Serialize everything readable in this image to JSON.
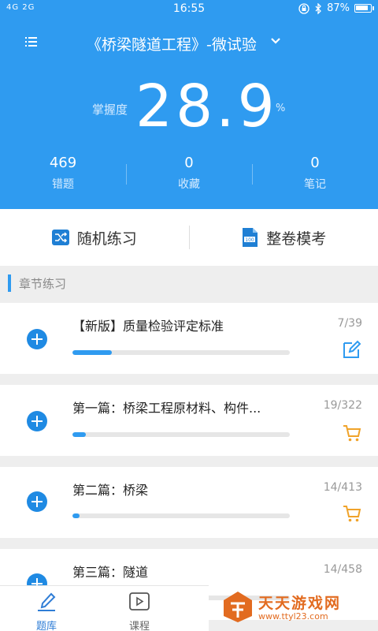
{
  "status_bar": {
    "signal": "4G 2G",
    "time": "16:55",
    "battery": "87%"
  },
  "header": {
    "title": "《桥梁隧道工程》-微试验",
    "mastery_label": "掌握度",
    "mastery_value": "28.9",
    "mastery_unit": "%",
    "stats": [
      {
        "value": "469",
        "label": "错题"
      },
      {
        "value": "0",
        "label": "收藏"
      },
      {
        "value": "0",
        "label": "笔记"
      }
    ]
  },
  "actions": {
    "random": "随机练习",
    "mock": "整卷模考",
    "mock_icon_text": "100"
  },
  "section": {
    "title": "章节练习"
  },
  "chapters": [
    {
      "name": "【新版】质量检验评定标准",
      "count": "7/39",
      "progress": 0.18,
      "icon": "edit-icon"
    },
    {
      "name": "第一篇：桥梁工程原材料、构件...",
      "count": "19/322",
      "progress": 0.06,
      "icon": "cart-icon"
    },
    {
      "name": "第二篇：桥梁",
      "count": "14/413",
      "progress": 0.034,
      "icon": "cart-icon"
    },
    {
      "name": "第三篇：隧道",
      "count": "14/458",
      "progress": 0.03,
      "icon": "cart-icon"
    }
  ],
  "tabbar": {
    "tabs": [
      {
        "label": "题库",
        "icon": "question-bank-icon"
      },
      {
        "label": "课程",
        "icon": "video-play-icon"
      }
    ]
  },
  "watermark": {
    "title": "天天游戏网",
    "url": "www.ttyl23.com"
  },
  "colors": {
    "primary": "#2f9bf0",
    "plus": "#1f8ae3",
    "edit_icon": "#2f9bf0",
    "cart_icon": "#f0a32a",
    "watermark": "#e26b20"
  }
}
